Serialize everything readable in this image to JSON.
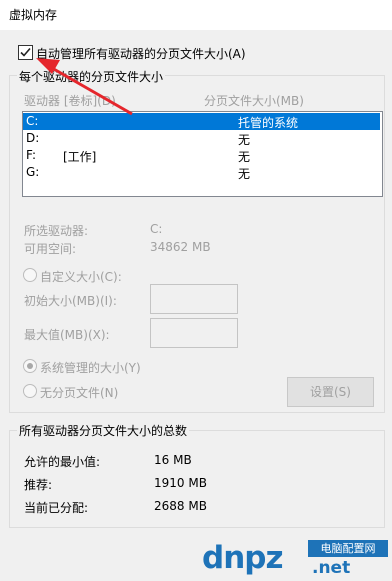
{
  "window": {
    "title": "虚拟内存"
  },
  "auto_manage": {
    "label": "自动管理所有驱动器的分页文件大小(A)",
    "checked": true
  },
  "drives_group": {
    "legend": "每个驱动器的分页文件大小",
    "col_drive": "驱动器 [卷标](D)",
    "col_size": "分页文件大小(MB)",
    "rows": [
      {
        "drive": "C:",
        "label": "",
        "size": "托管的系统",
        "selected": true
      },
      {
        "drive": "D:",
        "label": "",
        "size": "无",
        "selected": false
      },
      {
        "drive": "F:",
        "label": "[工作]",
        "size": "无",
        "selected": false
      },
      {
        "drive": "G:",
        "label": "",
        "size": "无",
        "selected": false
      }
    ],
    "selected_drive_label": "所选驱动器:",
    "selected_drive_value": "C:",
    "free_space_label": "可用空间:",
    "free_space_value": "34862 MB",
    "custom_size": "自定义大小(C):",
    "initial_size": "初始大小(MB)(I):",
    "max_size": "最大值(MB)(X):",
    "system_managed": "系统管理的大小(Y)",
    "no_paging": "无分页文件(N)",
    "set_button": "设置(S)"
  },
  "totals_group": {
    "legend": "所有驱动器分页文件大小的总数",
    "min_label": "允许的最小值:",
    "min_value": "16 MB",
    "recommended_label": "推荐:",
    "recommended_value": "1910 MB",
    "current_label": "当前已分配:",
    "current_value": "2688 MB"
  },
  "watermark": {
    "main": "dnpz",
    "tag": "电脑配置网",
    "domain": ".net"
  },
  "colors": {
    "selection": "#0078d7",
    "annotation_arrow": "#e5262c",
    "watermark": "#1e73b8"
  }
}
